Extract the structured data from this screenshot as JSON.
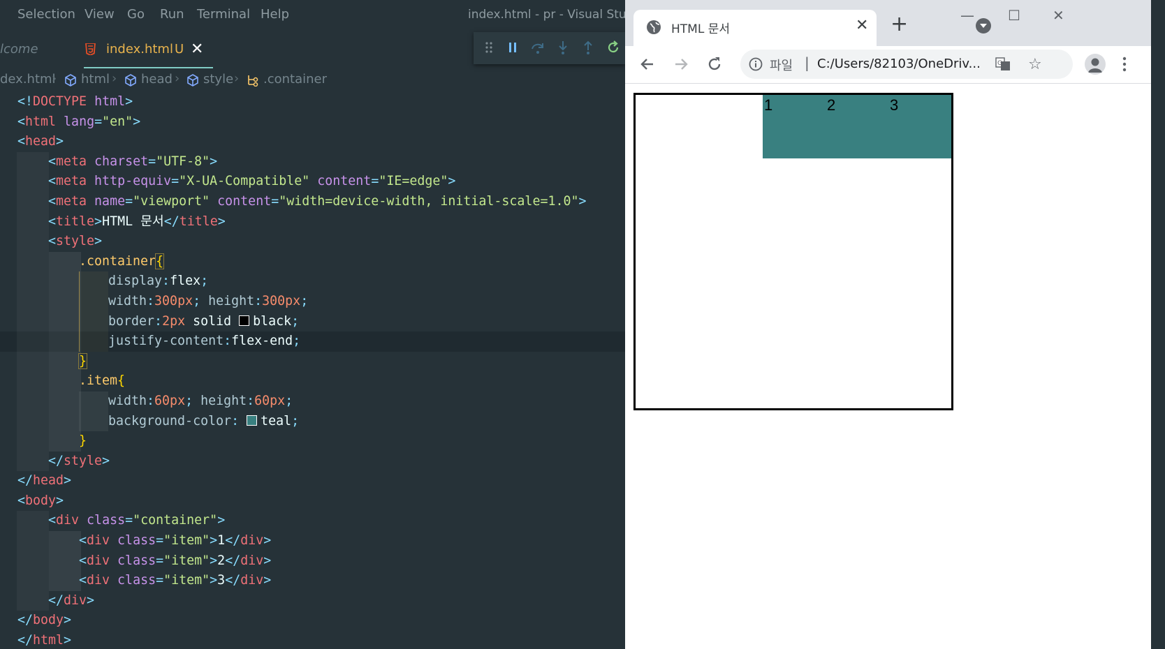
{
  "vscode": {
    "menu": [
      "Selection",
      "View",
      "Go",
      "Run",
      "Terminal",
      "Help"
    ],
    "window_title": "index.html - pr - Visual Studio Code",
    "tabs": {
      "welcome": "lcome",
      "index": {
        "label": "index.html",
        "badge": "U",
        "close": "✕"
      }
    },
    "breadcrumb": [
      "dex.html",
      "html",
      "head",
      "style",
      ".container"
    ],
    "code": {
      "l1": [
        "<!",
        "DOCTYPE",
        " html",
        ">"
      ],
      "l2": [
        "<",
        "html",
        " lang",
        "=",
        "\"en\"",
        ">"
      ],
      "l3": [
        "<",
        "head",
        ">"
      ],
      "l4": [
        "<",
        "meta",
        " charset",
        "=",
        "\"UTF-8\"",
        ">"
      ],
      "l5": [
        "<",
        "meta",
        " http-equiv",
        "=",
        "\"X-UA-Compatible\"",
        " content",
        "=",
        "\"IE=edge\"",
        ">"
      ],
      "l6": [
        "<",
        "meta",
        " name",
        "=",
        "\"viewport\"",
        " content",
        "=",
        "\"width=device-width, initial-scale=1.0\"",
        ">"
      ],
      "l7": [
        "<",
        "title",
        ">",
        "HTML 문서",
        "</",
        "title",
        ">"
      ],
      "l8": [
        "<",
        "style",
        ">"
      ],
      "l9": [
        ".container",
        "{"
      ],
      "l10": [
        "display",
        ":",
        "flex",
        ";"
      ],
      "l11": [
        "width",
        ":",
        "300px",
        ";",
        " height",
        ":",
        "300px",
        ";"
      ],
      "l12": [
        "border",
        ":",
        "2px",
        " solid ",
        "black",
        ";"
      ],
      "l13": [
        "justify-content",
        ":",
        "flex-end",
        ";"
      ],
      "l14": [
        "}"
      ],
      "l15": [
        ".item",
        "{"
      ],
      "l16": [
        "width",
        ":",
        "60px",
        ";",
        " height",
        ":",
        "60px",
        ";"
      ],
      "l17": [
        "background-color",
        ": ",
        "teal",
        ";"
      ],
      "l18": [
        "}"
      ],
      "l19": [
        "</",
        "style",
        ">"
      ],
      "l20": [
        "</",
        "head",
        ">"
      ],
      "l21": [
        "<",
        "body",
        ">"
      ],
      "l22": [
        "<",
        "div",
        " class",
        "=",
        "\"container\"",
        ">"
      ],
      "l23": [
        "<",
        "div",
        " class",
        "=",
        "\"item\"",
        ">",
        "1",
        "</",
        "div",
        ">"
      ],
      "l24": [
        "<",
        "div",
        " class",
        "=",
        "\"item\"",
        ">",
        "2",
        "</",
        "div",
        ">"
      ],
      "l25": [
        "<",
        "div",
        " class",
        "=",
        "\"item\"",
        ">",
        "3",
        "</",
        "div",
        ">"
      ],
      "l26": [
        "</",
        "div",
        ">"
      ],
      "l27": [
        "</",
        "body",
        ">"
      ],
      "l28": [
        "</",
        "html",
        ">"
      ]
    },
    "colors": {
      "background": "#263238",
      "swatch_black": "#000000",
      "swatch_teal": "#008080"
    }
  },
  "chrome": {
    "tab_title": "HTML 문서",
    "tab_close": "✕",
    "new_tab": "+",
    "window_buttons": [
      "—",
      "☐",
      "✕"
    ],
    "url_scheme": "파일",
    "url_sep": "|",
    "url": "C:/Users/82103/OneDriv...",
    "icons": [
      "globe-icon",
      "back-icon",
      "forward-icon",
      "reload-icon",
      "info-icon",
      "translate-icon",
      "star-icon",
      "profile-icon",
      "kebab-menu-icon"
    ],
    "page": {
      "items": [
        "1",
        "2",
        "3"
      ],
      "item_color": "#398080",
      "border_color": "#000000"
    }
  }
}
